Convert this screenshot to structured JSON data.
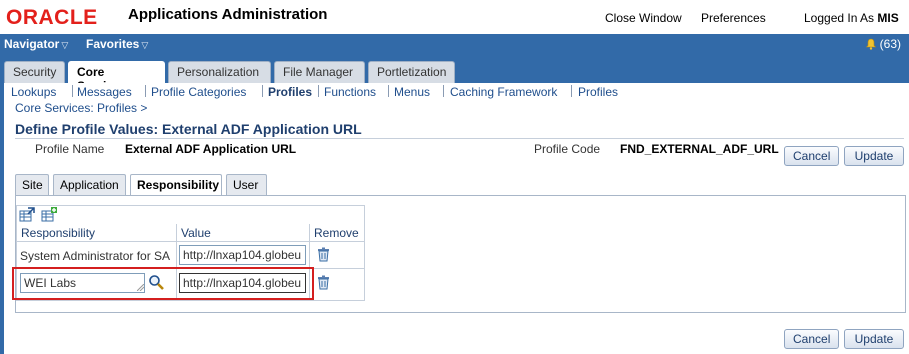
{
  "header": {
    "logo": "ORACLE",
    "app_title": "Applications Administration",
    "close_window": "Close Window",
    "preferences": "Preferences",
    "logged_in_prefix": "Logged In As",
    "logged_in_user": "MIS"
  },
  "navbar": {
    "navigator": "Navigator",
    "favorites": "Favorites",
    "notifications": "(63)"
  },
  "top_tabs": [
    {
      "label": "Security"
    },
    {
      "label": "Core Services",
      "active": true
    },
    {
      "label": "Personalization"
    },
    {
      "label": "File Manager"
    },
    {
      "label": "Portletization"
    }
  ],
  "sub_nav": [
    {
      "label": "Lookups"
    },
    {
      "label": "Messages"
    },
    {
      "label": "Profile Categories"
    },
    {
      "label": "Profiles",
      "active": true
    },
    {
      "label": "Functions"
    },
    {
      "label": "Menus"
    },
    {
      "label": "Caching Framework"
    },
    {
      "label": "Profiles"
    }
  ],
  "breadcrumb": "Core Services: Profiles  >",
  "page_title": "Define Profile Values: External ADF Application URL",
  "profile": {
    "name_label": "Profile Name",
    "name_value": "External ADF Application URL",
    "code_label": "Profile Code",
    "code_value": "FND_EXTERNAL_ADF_URL"
  },
  "buttons": {
    "cancel": "Cancel",
    "update": "Update"
  },
  "inner_tabs": [
    {
      "label": "Site"
    },
    {
      "label": "Application"
    },
    {
      "label": "Responsibility",
      "active": true
    },
    {
      "label": "User"
    }
  ],
  "table": {
    "headers": [
      "Responsibility",
      "Value",
      "Remove"
    ],
    "rows": [
      {
        "responsibility": "System Administrator for SA",
        "value": "http://lnxap104.globeu"
      },
      {
        "responsibility": "WEI Labs",
        "value": "http://lnxap104.globeu"
      }
    ]
  },
  "colors": {
    "brand": "#e3201b",
    "navbar": "#326aa8",
    "highlight": "#d41f1f"
  },
  "icons": [
    "bell-icon",
    "export-icon",
    "add-row-icon",
    "trash-icon",
    "search-icon",
    "chevron-down-icon"
  ]
}
